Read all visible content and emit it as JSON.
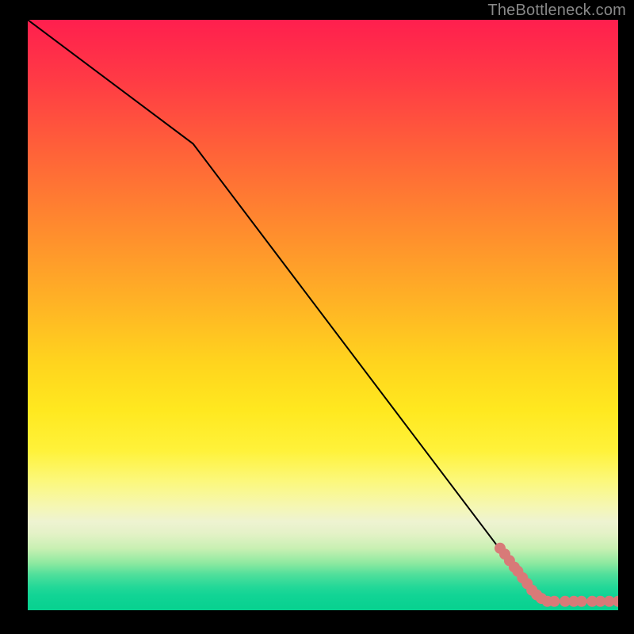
{
  "watermark": "TheBottleneck.com",
  "colors": {
    "line": "#000000",
    "marker_fill": "#d87a78",
    "marker_stroke": "#b85654",
    "background": "#000000"
  },
  "chart_data": {
    "type": "line",
    "title": "",
    "xlabel": "",
    "ylabel": "",
    "xlim": [
      0,
      100
    ],
    "ylim": [
      0,
      100
    ],
    "line_points": [
      {
        "x": 0,
        "y": 100
      },
      {
        "x": 28,
        "y": 79
      },
      {
        "x": 84,
        "y": 5
      },
      {
        "x": 88,
        "y": 1.5
      },
      {
        "x": 100,
        "y": 1.5
      }
    ],
    "scatter_points": [
      {
        "x": 80.0,
        "y": 10.5
      },
      {
        "x": 80.8,
        "y": 9.5
      },
      {
        "x": 81.6,
        "y": 8.4
      },
      {
        "x": 82.4,
        "y": 7.3
      },
      {
        "x": 83.0,
        "y": 6.6
      },
      {
        "x": 83.8,
        "y": 5.5
      },
      {
        "x": 84.6,
        "y": 4.5
      },
      {
        "x": 85.4,
        "y": 3.4
      },
      {
        "x": 86.2,
        "y": 2.6
      },
      {
        "x": 87.0,
        "y": 2.0
      },
      {
        "x": 88.0,
        "y": 1.5
      },
      {
        "x": 89.2,
        "y": 1.5
      },
      {
        "x": 91.0,
        "y": 1.5
      },
      {
        "x": 92.5,
        "y": 1.5
      },
      {
        "x": 93.8,
        "y": 1.5
      },
      {
        "x": 95.6,
        "y": 1.5
      },
      {
        "x": 97.0,
        "y": 1.5
      },
      {
        "x": 98.5,
        "y": 1.5
      },
      {
        "x": 100.0,
        "y": 1.5
      }
    ],
    "gradient_stops": [
      {
        "y": 100,
        "color": "#ff1f4e"
      },
      {
        "y": 65,
        "color": "#ff8a2e"
      },
      {
        "y": 40,
        "color": "#ffd41e"
      },
      {
        "y": 20,
        "color": "#fcf87a"
      },
      {
        "y": 8,
        "color": "#8ee9a0"
      },
      {
        "y": 0,
        "color": "#07d18f"
      }
    ]
  }
}
